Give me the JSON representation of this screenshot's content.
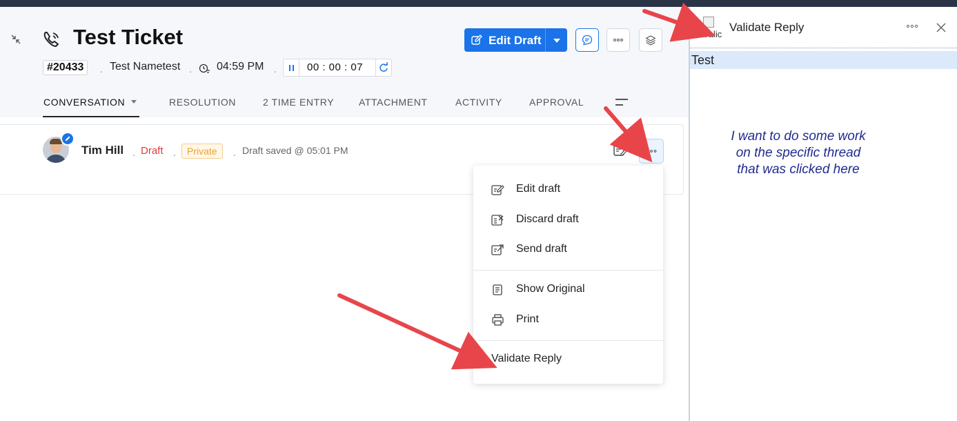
{
  "ticket": {
    "title": "Test Ticket",
    "id": "#20433",
    "contact": "Test Nametest",
    "time": "04:59 PM",
    "timer": "00 : 00 : 07"
  },
  "actions": {
    "edit_draft": "Edit Draft"
  },
  "tabs": [
    {
      "label": "CONVERSATION"
    },
    {
      "label": "RESOLUTION"
    },
    {
      "label": "2 TIME ENTRY"
    },
    {
      "label": "ATTACHMENT"
    },
    {
      "label": "ACTIVITY"
    },
    {
      "label": "APPROVAL"
    }
  ],
  "thread": {
    "author": "Tim Hill",
    "status": "Draft",
    "visibility": "Private",
    "saved": "Draft saved @ 05:01 PM"
  },
  "menu": {
    "items": [
      {
        "label": "Edit draft"
      },
      {
        "label": "Discard draft"
      },
      {
        "label": "Send draft"
      },
      {
        "label": "Show Original"
      },
      {
        "label": "Print"
      },
      {
        "label": "Validate Reply"
      }
    ]
  },
  "right_panel": {
    "image_alt": "Valic",
    "title": "Validate Reply",
    "content": "Test"
  },
  "annotation": {
    "line1": "I want to do some work",
    "line2": "on the specific thread",
    "line3": "that was clicked here"
  },
  "colors": {
    "primary": "#1a73e8",
    "draft": "#e03b3b",
    "private": "#f0a02c",
    "annotation": "#1f2c8f",
    "arrow": "#e8454a"
  }
}
